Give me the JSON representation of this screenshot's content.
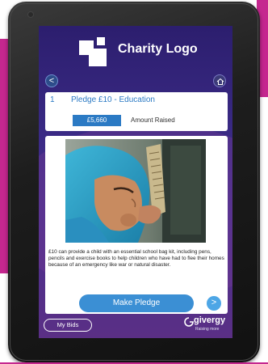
{
  "header": {
    "logo_text": "Charity Logo"
  },
  "nav": {
    "back_glyph": "<",
    "back_icon": "chevron-left-icon",
    "home_icon": "home-icon"
  },
  "pledge": {
    "number": "1",
    "title": "Pledge £10 - Education",
    "amount": "£5,660",
    "amount_label": "Amount Raised"
  },
  "content": {
    "description": "£10 can provide a child with an essential school bag kit, including pens, pencils and exercise books to help children who have had to flee their homes because of an emergency like war or natural disaster.",
    "make_pledge_label": "Make Pledge",
    "next_glyph": ">"
  },
  "footer": {
    "my_bids_label": "My Bids",
    "brand_name": "givergy",
    "brand_tagline": "Raising more"
  },
  "colors": {
    "accent_blue": "#2b7ac4",
    "button_blue": "#3b8fd4",
    "screen_purple": "#3a2a85",
    "magenta": "#c5278f"
  }
}
